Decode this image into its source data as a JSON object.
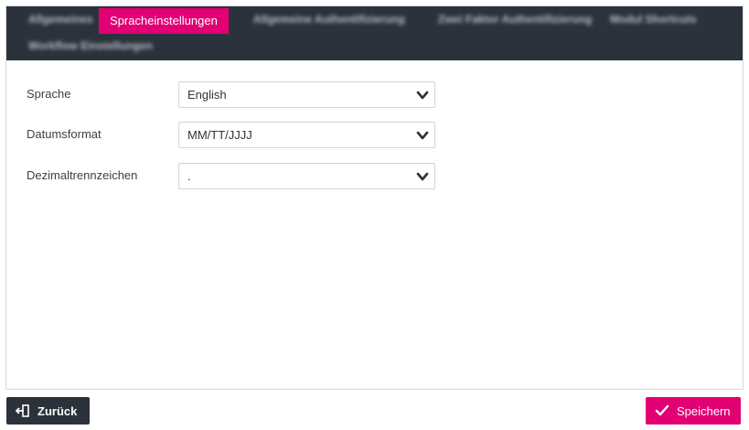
{
  "tabs": [
    {
      "label": "Allgemeines",
      "active": false
    },
    {
      "label": "Spracheinstellungen",
      "active": true
    },
    {
      "label": "Allgemeine Authentifizierung",
      "active": false
    },
    {
      "label": "Zwei Faktor Authentifizierung",
      "active": false
    },
    {
      "label": "Modul Shortcuts",
      "active": false
    },
    {
      "label": "Workflow Einstellungen",
      "active": false
    }
  ],
  "form": {
    "language": {
      "label": "Sprache",
      "value": "English"
    },
    "date_format": {
      "label": "Datumsformat",
      "value": "MM/TT/JJJJ"
    },
    "decimal_separator": {
      "label": "Dezimaltrennzeichen",
      "value": "."
    }
  },
  "footer": {
    "back_label": "Zurück",
    "save_label": "Speichern"
  },
  "colors": {
    "accent": "#e20074",
    "dark": "#2b323b"
  },
  "icons": {
    "back": "exit-door-icon",
    "save": "checkmark-icon",
    "dropdown": "chevron-down-icon"
  }
}
